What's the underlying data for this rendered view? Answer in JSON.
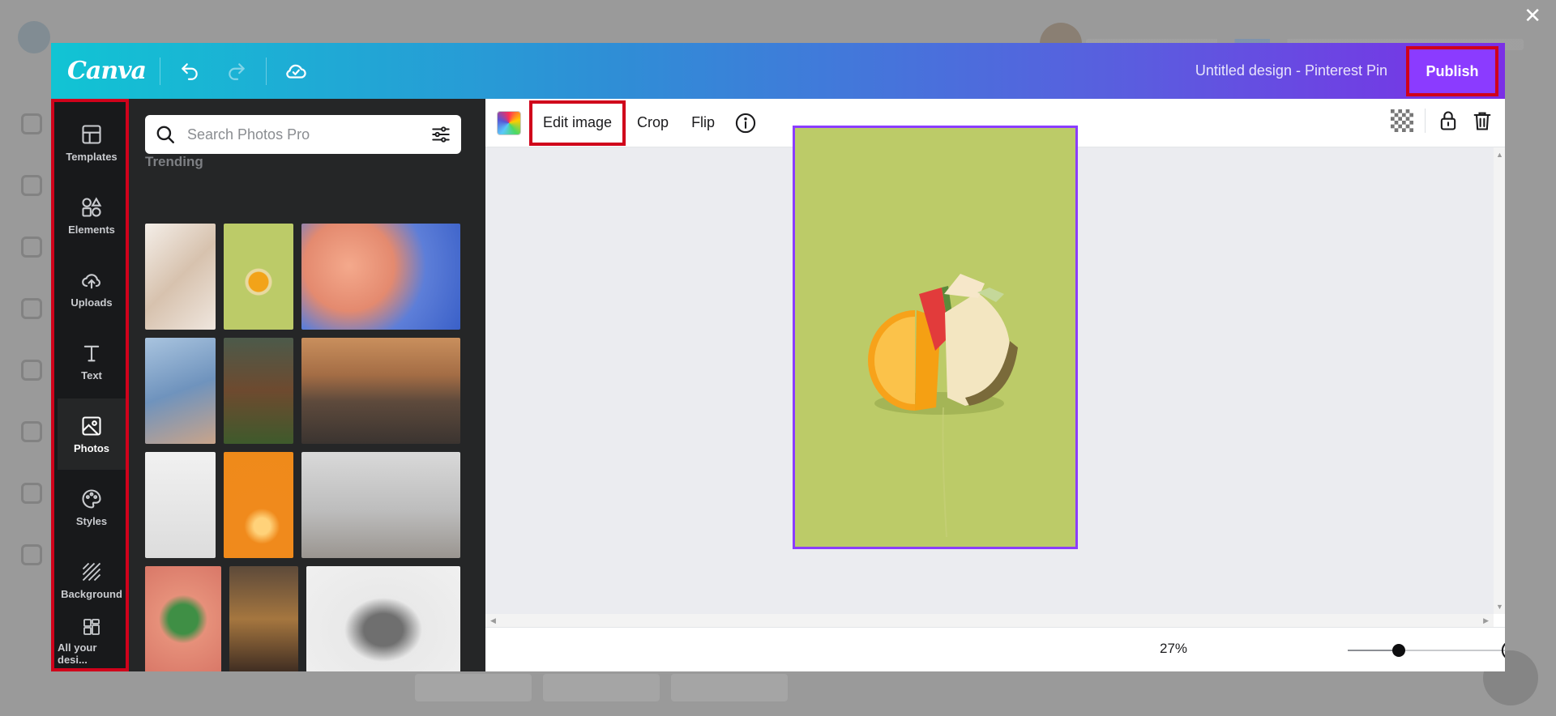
{
  "app": {
    "brand": "Canva",
    "document_title": "Untitled design - Pinterest Pin",
    "publish_label": "Publish",
    "close_glyph": "✕"
  },
  "rail": {
    "items": [
      {
        "label": "Templates",
        "icon": "templates-icon"
      },
      {
        "label": "Elements",
        "icon": "elements-icon"
      },
      {
        "label": "Uploads",
        "icon": "upload-cloud-icon"
      },
      {
        "label": "Text",
        "icon": "text-icon"
      },
      {
        "label": "Photos",
        "icon": "photo-icon",
        "active": true
      },
      {
        "label": "Styles",
        "icon": "palette-icon"
      },
      {
        "label": "Background",
        "icon": "background-icon"
      },
      {
        "label": "All your desi...",
        "icon": "designs-icon"
      }
    ]
  },
  "panel": {
    "search_placeholder": "Search Photos Pro",
    "section_title": "Trending",
    "collapse_glyph": "‹"
  },
  "toolbar": {
    "edit_image": "Edit image",
    "crop": "Crop",
    "flip": "Flip"
  },
  "zoom": {
    "label": "27%",
    "level": 0.25
  },
  "colors": {
    "accent": "#8b3dff",
    "highlight": "#d0021b",
    "artboard_bg": "#bccb68"
  }
}
